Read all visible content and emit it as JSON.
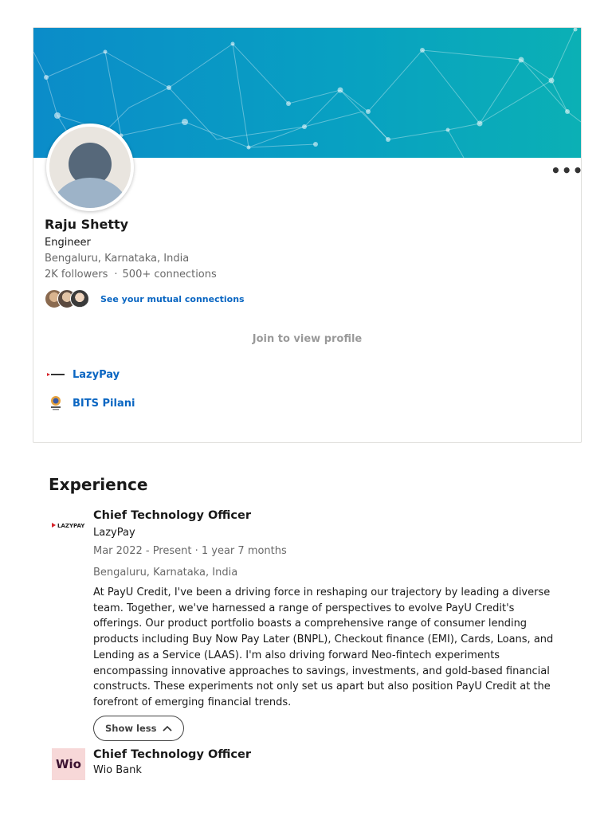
{
  "profile": {
    "name": "Raju Shetty",
    "headline": "Engineer",
    "location": "Bengaluru, Karnataka, India",
    "followers": "2K followers",
    "separator": "·",
    "connections": "500+ connections",
    "mutual_link": "See your mutual connections",
    "join_cta": "Join to view profile",
    "more_menu": "more-horizontal-icon",
    "orgs": [
      {
        "label": "LazyPay",
        "icon": "lazypay-logo-icon"
      },
      {
        "label": "BITS Pilani",
        "icon": "bits-pilani-logo-icon"
      }
    ]
  },
  "experience": {
    "section_title": "Experience",
    "items": [
      {
        "role": "Chief Technology Officer",
        "company": "LazyPay",
        "logo_text": "LAZYPAY",
        "dates": "Mar 2022 - Present · 1 year 7 months",
        "location": "Bengaluru, Karnataka, India",
        "description": "At PayU Credit, I've been a driving force in reshaping our trajectory by leading a diverse team. Together, we've harnessed a range of perspectives to evolve PayU Credit's offerings. Our product portfolio boasts a comprehensive range of consumer lending products including Buy Now Pay Later (BNPL), Checkout finance (EMI), Cards, Loans, and Lending as a Service (LAAS). I'm also driving forward Neo-fintech experiments encompassing innovative approaches to savings, investments, and gold-based financial constructs. These experiments not only set us apart but also position PayU Credit at the forefront of emerging financial trends.",
        "toggle_label": "Show less"
      },
      {
        "role": "Chief Technology Officer",
        "company": "Wio Bank",
        "logo_text": "Wio"
      }
    ]
  },
  "colors": {
    "link": "#0a66c2",
    "banner_start": "#0b8cc9",
    "banner_end": "#0bb0b5",
    "wio_logo_bg": "#f7d8d8"
  }
}
